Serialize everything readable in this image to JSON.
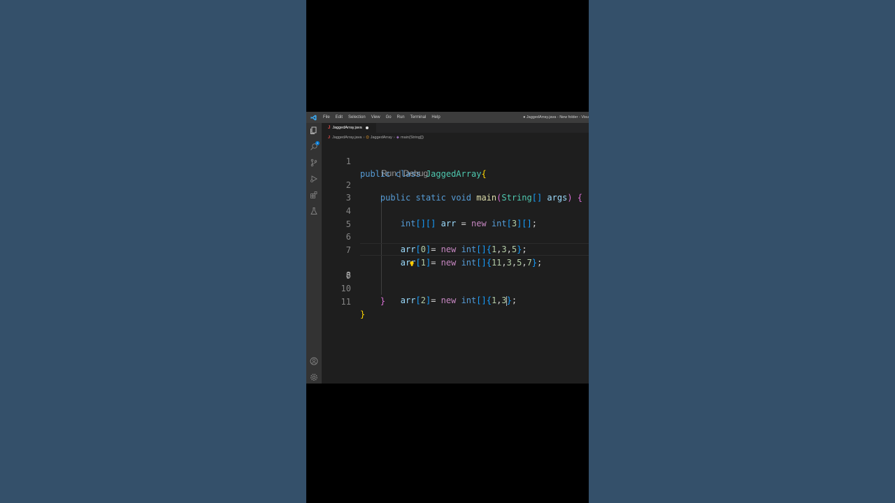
{
  "titlebar": {
    "menu": [
      "File",
      "Edit",
      "Selection",
      "View",
      "Go",
      "Run",
      "Terminal",
      "Help"
    ],
    "window_title": "● JaggedArray.java - New folder - Visu"
  },
  "activitybar": {
    "icons": [
      "files-icon",
      "search-icon",
      "source-control-icon",
      "run-debug-icon",
      "extensions-icon",
      "testing-icon",
      "account-icon",
      "settings-gear-icon"
    ],
    "badge": "1"
  },
  "tab": {
    "label": "JaggedArray.java",
    "file_icon": "J",
    "unsaved": true
  },
  "breadcrumb": {
    "file": "JaggedArray.java",
    "class": "JaggedArray",
    "method": "main(String[])"
  },
  "editor": {
    "line_numbers": [
      "1",
      "2",
      "3",
      "4",
      "5",
      "6",
      "7",
      "8",
      "9",
      "10",
      "11"
    ],
    "current_line": "8",
    "codelens": "Run | Debug",
    "lines": [
      "public class JaggedArray{",
      "    public static void main(String[] args) {",
      "",
      "        int[][] arr = new int[3][];",
      "",
      "        arr[0]= new int[]{1,3,5};",
      "        arr[1]= new int[]{11,3,5,7};",
      "        arr[2]= new int[]{1,3};",
      "",
      "    }",
      "}"
    ]
  },
  "colors": {
    "background": "#34506a",
    "editor_bg": "#1e1e1e",
    "keyword": "#569cd6",
    "control_keyword": "#c586c0",
    "class": "#4ec9b0",
    "function": "#dcdcaa",
    "variable": "#9cdcfe",
    "number": "#b5cea8"
  }
}
